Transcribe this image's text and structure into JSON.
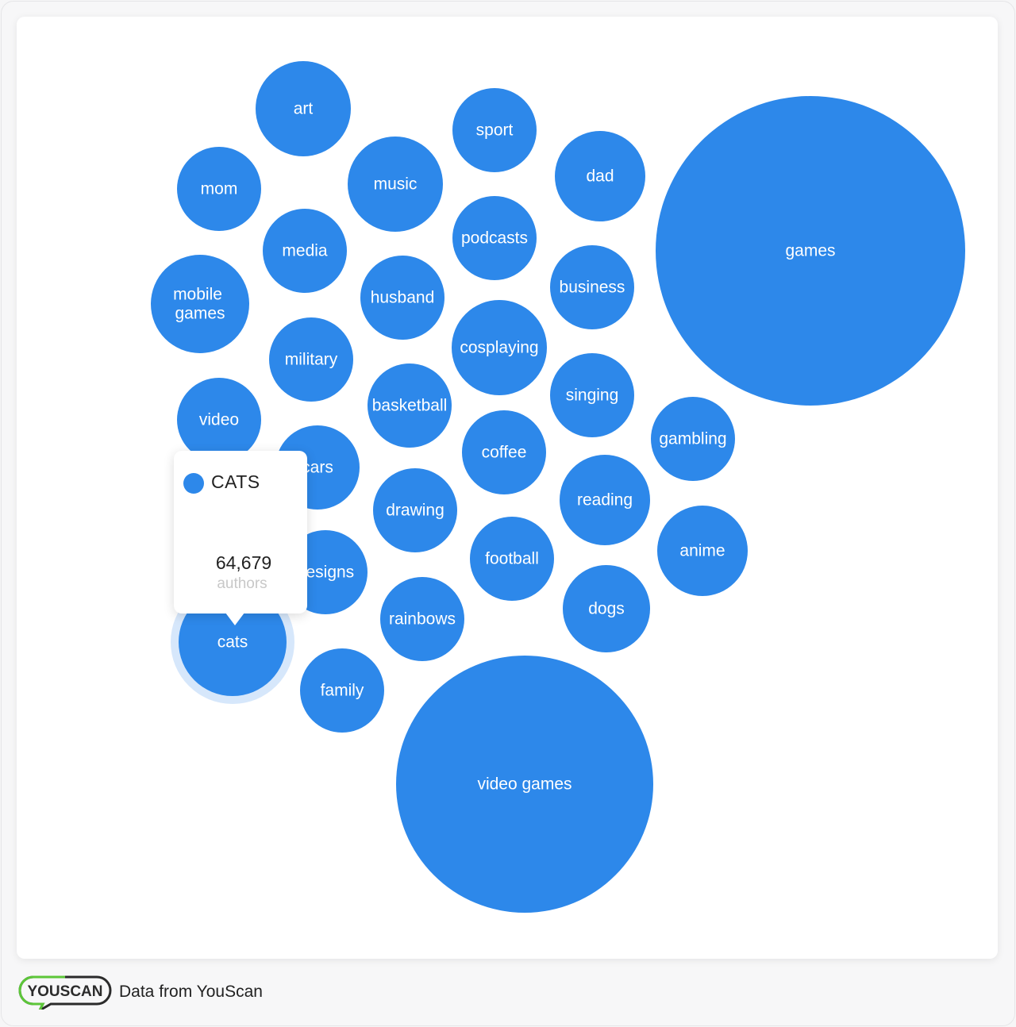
{
  "chart_data": {
    "type": "bubble",
    "title": "",
    "metric": "authors",
    "color": "#2d88ea",
    "highlight_color": "#d6e7fb",
    "bubbles": [
      {
        "label": "games"
      },
      {
        "label": "video games"
      },
      {
        "label": "art"
      },
      {
        "label": "music"
      },
      {
        "label": "cosplaying"
      },
      {
        "label": "mobile games"
      },
      {
        "label": "cats",
        "value": 64679,
        "highlighted": true
      },
      {
        "label": "reading"
      },
      {
        "label": "dad"
      },
      {
        "label": "anime"
      },
      {
        "label": "dogs"
      },
      {
        "label": "sport"
      },
      {
        "label": "podcasts"
      },
      {
        "label": "business"
      },
      {
        "label": "singing"
      },
      {
        "label": "coffee"
      },
      {
        "label": "football"
      },
      {
        "label": "gambling"
      },
      {
        "label": "mom"
      },
      {
        "label": "media"
      },
      {
        "label": "husband"
      },
      {
        "label": "military"
      },
      {
        "label": "basketball"
      },
      {
        "label": "video"
      },
      {
        "label": "cars"
      },
      {
        "label": "drawing"
      },
      {
        "label": "designs"
      },
      {
        "label": "rainbows"
      },
      {
        "label": "family"
      }
    ]
  },
  "tooltip": {
    "title": "CATS",
    "value": "64,679",
    "unit": "authors",
    "dot_color": "#2d88ea"
  },
  "footer": {
    "logo_text": "YOUSCAN",
    "text": "Data from YouScan",
    "logo_green": "#5cc639",
    "logo_dark": "#2b2b2b"
  }
}
